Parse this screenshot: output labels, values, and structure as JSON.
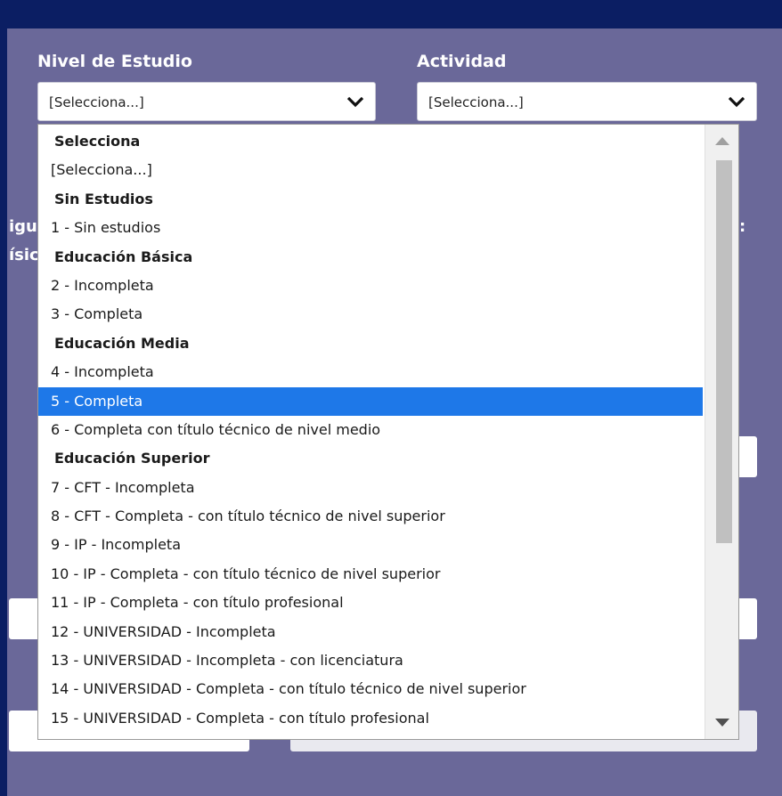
{
  "form": {
    "nivel_label": "Nivel de Estudio",
    "nivel_value": "[Selecciona...]",
    "actividad_label": "Actividad",
    "actividad_value": "[Selecciona...]"
  },
  "background_text": {
    "left_line1": "igu",
    "left_line2": "ísic",
    "right_colon": ":"
  },
  "dropdown": {
    "rows": [
      {
        "type": "group",
        "label": "Selecciona"
      },
      {
        "type": "option",
        "label": "[Selecciona...]"
      },
      {
        "type": "group",
        "label": "Sin Estudios"
      },
      {
        "type": "option",
        "label": "1 - Sin estudios"
      },
      {
        "type": "group",
        "label": "Educación Básica"
      },
      {
        "type": "option",
        "label": "2 - Incompleta"
      },
      {
        "type": "option",
        "label": "3 - Completa"
      },
      {
        "type": "group",
        "label": "Educación Media"
      },
      {
        "type": "option",
        "label": "4 - Incompleta"
      },
      {
        "type": "option",
        "label": "5 - Completa",
        "selected": true
      },
      {
        "type": "option",
        "label": "6 - Completa con título técnico de nivel medio"
      },
      {
        "type": "group",
        "label": "Educación Superior"
      },
      {
        "type": "option",
        "label": "7 - CFT - Incompleta"
      },
      {
        "type": "option",
        "label": "8 - CFT - Completa - con título técnico de nivel superior"
      },
      {
        "type": "option",
        "label": "9 - IP - Incompleta"
      },
      {
        "type": "option",
        "label": "10 - IP - Completa - con título técnico de nivel superior"
      },
      {
        "type": "option",
        "label": "11 - IP - Completa - con título profesional"
      },
      {
        "type": "option",
        "label": "12 - UNIVERSIDAD - Incompleta"
      },
      {
        "type": "option",
        "label": "13 - UNIVERSIDAD - Incompleta - con licenciatura"
      },
      {
        "type": "option",
        "label": "14 - UNIVERSIDAD - Completa - con título técnico de nivel superior"
      },
      {
        "type": "option",
        "label": "15 - UNIVERSIDAD - Completa - con título profesional"
      }
    ]
  },
  "colors": {
    "outer_frame": "#0b1e63",
    "panel": "#6a6899",
    "selection": "#1e78e8"
  }
}
